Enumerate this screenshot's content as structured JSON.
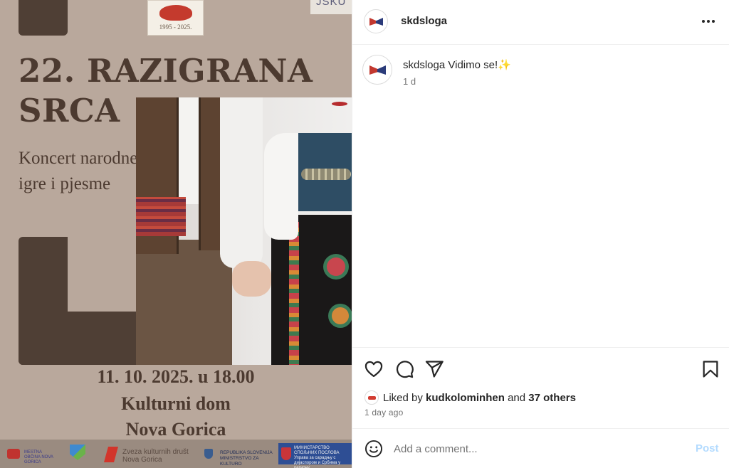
{
  "poster": {
    "title": "22. RAZIGRANA SRCA",
    "subtitle": "Koncert narodne igre i pjesme",
    "date_time": "11. 10. 2025. u 18.00",
    "venue_line1": "Kulturni dom",
    "venue_line2": "Nova Gorica",
    "top_logo_year": "1995 - 2025.",
    "top_right_logo": "JSKU",
    "sponsors": [
      {
        "name": "MESTNA OBČINA NOVA GORICA"
      },
      {
        "name": ""
      },
      {
        "name": "Zveza kulturnih društ Nova Gorica"
      },
      {
        "name": "REPUBLIKA SLOVENIJA MINISTRSTVO ZA KULTURO"
      },
      {
        "name": "МИНИСТАРСТВО СПОЉНИХ ПОСЛОВА Управа за сарадњу с дијаспором и Србима у региону"
      }
    ]
  },
  "post": {
    "username": "skdsloga",
    "caption_username": "skdsloga",
    "caption_text": "Vidimo se!",
    "caption_emoji": "✨",
    "caption_time": "1 d",
    "liked_by_prefix": "Liked by ",
    "liked_by_user": "kudkolominhen",
    "liked_by_mid": " and ",
    "liked_by_others": "37 others",
    "date": "1 day ago"
  },
  "comment": {
    "placeholder": "Add a comment...",
    "post_label": "Post"
  },
  "icons": {
    "more": "more-horizontal-icon",
    "like": "heart-icon",
    "comment": "comment-bubble-icon",
    "share": "paper-plane-icon",
    "save": "bookmark-icon",
    "emoji": "smiley-icon"
  },
  "colors": {
    "poster_bg": "#b9a89c",
    "poster_dark": "#4f3f35",
    "post_button_disabled": "#b3dbff",
    "muted_text": "#737373"
  }
}
